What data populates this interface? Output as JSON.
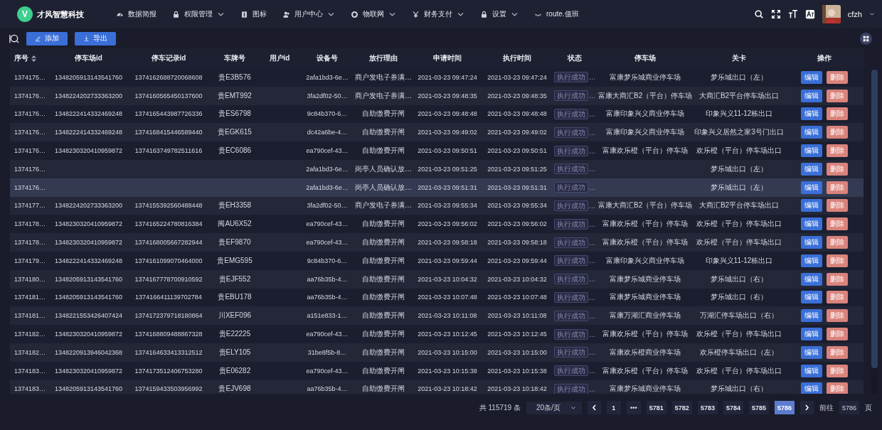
{
  "brand": {
    "logo_letter": "V",
    "name": "才风智慧科技"
  },
  "nav": [
    {
      "label": "数据简报",
      "kind": "dashboard",
      "dropdown": false
    },
    {
      "label": "权限管理",
      "kind": "lock",
      "dropdown": true
    },
    {
      "label": "图标",
      "kind": "info",
      "dropdown": false
    },
    {
      "label": "用户中心",
      "kind": "users",
      "dropdown": true
    },
    {
      "label": "物联网",
      "kind": "ring",
      "dropdown": true
    },
    {
      "label": "财务支付",
      "kind": "yen",
      "dropdown": true
    },
    {
      "label": "设置",
      "kind": "lock",
      "dropdown": true
    },
    {
      "label": "route.值班",
      "kind": "eye",
      "dropdown": false
    }
  ],
  "user": {
    "name": "cfzh"
  },
  "toolbar": {
    "buttons": [
      {
        "label": "添加",
        "kind": "edit"
      },
      {
        "label": "导出",
        "kind": "download"
      }
    ]
  },
  "table": {
    "columns": [
      {
        "label": "序号",
        "sortable": true
      },
      {
        "label": "停车场id",
        "sortable": false
      },
      {
        "label": "停车记录id",
        "sortable": false
      },
      {
        "label": "车牌号",
        "sortable": false
      },
      {
        "label": "用户id",
        "sortable": false
      },
      {
        "label": "设备号",
        "sortable": false
      },
      {
        "label": "放行理由",
        "sortable": false
      },
      {
        "label": "申请时间",
        "sortable": false
      },
      {
        "label": "执行时间",
        "sortable": false
      },
      {
        "label": "状态",
        "sortable": false
      },
      {
        "label": "停车场",
        "sortable": false
      },
      {
        "label": "关卡",
        "sortable": false
      },
      {
        "label": "操作",
        "sortable": false
      }
    ],
    "rows": [
      {
        "serial": "1374175…",
        "lot_id": "1348205913143541760",
        "record_id": "1374162688720068608",
        "plate": "贵E3B576",
        "device": "2afa1bd3-6e…",
        "reason": "商户发电子券满…",
        "apply_time": "2021-03-23 09:47:24",
        "exec_time": "2021-03-23 09:47:24",
        "status": "执行成功",
        "status_cut": "…",
        "lot": "富康梦乐城商业停车场",
        "gate": "梦乐城出口（左）",
        "edit": "编辑",
        "delete": "删除",
        "highlighted": false
      },
      {
        "serial": "1374176…",
        "lot_id": "1348224202733363200",
        "record_id": "1374160565450137600",
        "plate": "贵EMT992",
        "device": "3fa2df02-50…",
        "reason": "商户发电子券满…",
        "apply_time": "2021-03-23 09:48:35",
        "exec_time": "2021-03-23 09:48:35",
        "status": "执行成功",
        "status_cut": "…",
        "lot": "富康大商汇B2（平台）停车场",
        "gate": "大商汇B2平台停车场出口",
        "edit": "编辑",
        "delete": "删除",
        "highlighted": false
      },
      {
        "serial": "1374176…",
        "lot_id": "1348222414332469248",
        "record_id": "1374165443987726336",
        "plate": "贵ES6798",
        "device": "9c84b370-6…",
        "reason": "自助缴费开闸",
        "apply_time": "2021-03-23 09:48:48",
        "exec_time": "2021-03-23 09:48:48",
        "status": "执行成功",
        "status_cut": "…",
        "lot": "富康印象兴义商业停车场",
        "gate": "印象兴义11-12栋出口",
        "edit": "编辑",
        "delete": "删除",
        "highlighted": false
      },
      {
        "serial": "1374176…",
        "lot_id": "1348222414332469248",
        "record_id": "1374168415446589440",
        "plate": "贵EGK615",
        "device": "dc42a6be-4…",
        "reason": "自助缴费开闸",
        "apply_time": "2021-03-23 09:49:02",
        "exec_time": "2021-03-23 09:49:02",
        "status": "执行成功",
        "status_cut": "…",
        "lot": "富康印象兴义商业停车场",
        "gate": "印象兴义居然之家3号门出口",
        "edit": "编辑",
        "delete": "删除",
        "highlighted": false
      },
      {
        "serial": "1374176…",
        "lot_id": "1348230320410959872",
        "record_id": "1374163749782511616",
        "plate": "贵EC6086",
        "device": "ea790cef-43…",
        "reason": "自助缴费开闸",
        "apply_time": "2021-03-23 09:50:51",
        "exec_time": "2021-03-23 09:50:51",
        "status": "执行成功",
        "status_cut": "…",
        "lot": "富康欢乐橙（平台）停车场",
        "gate": "欢乐橙（平台）停车场出口",
        "edit": "编辑",
        "delete": "删除",
        "highlighted": false
      },
      {
        "serial": "1374176…",
        "device": "2afa1bd3-6e…",
        "reason": "岗亭人员确认放…",
        "apply_time": "2021-03-23 09:51:25",
        "exec_time": "2021-03-23 09:51:25",
        "status": "执行成功",
        "status_cut": "…",
        "gate": "梦乐城出口（左）",
        "edit": "编辑",
        "delete": "删除",
        "highlighted": false
      },
      {
        "serial": "1374176…",
        "device": "2afa1bd3-6e…",
        "reason": "岗亭人员确认放…",
        "apply_time": "2021-03-23 09:51:31",
        "exec_time": "2021-03-23 09:51:31",
        "status": "执行成功",
        "status_cut": "…",
        "gate": "梦乐城出口（左）",
        "edit": "编辑",
        "delete": "删除",
        "highlighted": true
      },
      {
        "serial": "1374177…",
        "lot_id": "1348224202733363200",
        "record_id": "1374155392560488448",
        "plate": "贵EH3358",
        "device": "3fa2df02-50…",
        "reason": "商户发电子券满…",
        "apply_time": "2021-03-23 09:55:34",
        "exec_time": "2021-03-23 09:55:34",
        "status": "执行成功",
        "status_cut": "…",
        "lot": "富康大商汇B2（平台）停车场",
        "gate": "大商汇B2平台停车场出口",
        "edit": "编辑",
        "delete": "删除",
        "highlighted": false
      },
      {
        "serial": "1374178…",
        "lot_id": "1348230320410959872",
        "record_id": "1374165224780816384",
        "plate": "闽AU6X52",
        "device": "ea790cef-43…",
        "reason": "自助缴费开闸",
        "apply_time": "2021-03-23 09:56:02",
        "exec_time": "2021-03-23 09:56:02",
        "status": "执行成功",
        "status_cut": "…",
        "lot": "富康欢乐橙（平台）停车场",
        "gate": "欢乐橙（平台）停车场出口",
        "edit": "编辑",
        "delete": "删除",
        "highlighted": false
      },
      {
        "serial": "1374178…",
        "lot_id": "1348230320410959872",
        "record_id": "1374168005667282944",
        "plate": "贵EF9870",
        "device": "ea790cef-43…",
        "reason": "自助缴费开闸",
        "apply_time": "2021-03-23 09:58:18",
        "exec_time": "2021-03-23 09:58:18",
        "status": "执行成功",
        "status_cut": "…",
        "lot": "富康欢乐橙（平台）停车场",
        "gate": "欢乐橙（平台）停车场出口",
        "edit": "编辑",
        "delete": "删除",
        "highlighted": false
      },
      {
        "serial": "1374179…",
        "lot_id": "1348222414332469248",
        "record_id": "1374161099070464000",
        "plate": "贵EMG595",
        "device": "9c84b370-6…",
        "reason": "自助缴费开闸",
        "apply_time": "2021-03-23 09:59:44",
        "exec_time": "2021-03-23 09:59:44",
        "status": "执行成功",
        "status_cut": "…",
        "lot": "富康印象兴义商业停车场",
        "gate": "印象兴义11-12栋出口",
        "edit": "编辑",
        "delete": "删除",
        "highlighted": false
      },
      {
        "serial": "1374180…",
        "lot_id": "1348205913143541760",
        "record_id": "1374167778700910592",
        "plate": "贵EJF552",
        "device": "aa76b35b-4…",
        "reason": "自助缴费开闸",
        "apply_time": "2021-03-23 10:04:32",
        "exec_time": "2021-03-23 10:04:32",
        "status": "执行成功",
        "status_cut": "…",
        "lot": "富康梦乐城商业停车场",
        "gate": "梦乐城出口（右）",
        "edit": "编辑",
        "delete": "删除",
        "highlighted": false
      },
      {
        "serial": "1374181…",
        "lot_id": "1348205913143541760",
        "record_id": "1374166411139702784",
        "plate": "贵EBU178",
        "device": "aa76b35b-4…",
        "reason": "自助缴费开闸",
        "apply_time": "2021-03-23 10:07:48",
        "exec_time": "2021-03-23 10:07:48",
        "status": "执行成功",
        "status_cut": "…",
        "lot": "富康梦乐城商业停车场",
        "gate": "梦乐城出口（右）",
        "edit": "编辑",
        "delete": "删除",
        "highlighted": false
      },
      {
        "serial": "1374181…",
        "lot_id": "1348221553426407424",
        "record_id": "1374172379718180864",
        "plate": "川XEF096",
        "device": "a151e833-1…",
        "reason": "自助缴费开闸",
        "apply_time": "2021-03-23 10:11:08",
        "exec_time": "2021-03-23 10:11:08",
        "status": "执行成功",
        "status_cut": "…",
        "lot": "富康万湖汇商业停车场",
        "gate": "万湖汇停车场出口（右）",
        "edit": "编辑",
        "delete": "删除",
        "highlighted": false
      },
      {
        "serial": "1374182…",
        "lot_id": "1348230320410959872",
        "record_id": "1374168809488867328",
        "plate": "贵E22225",
        "device": "ea790cef-43…",
        "reason": "自助缴费开闸",
        "apply_time": "2021-03-23 10:12:45",
        "exec_time": "2021-03-23 10:12:45",
        "status": "执行成功",
        "status_cut": "…",
        "lot": "富康欢乐橙（平台）停车场",
        "gate": "欢乐橙（平台）停车场出口",
        "edit": "编辑",
        "delete": "删除",
        "highlighted": false
      },
      {
        "serial": "1374182…",
        "lot_id": "1348220913946042368",
        "record_id": "1374164633413312512",
        "plate": "贵ELY105",
        "device": "31be8f5b-8…",
        "reason": "自助缴费开闸",
        "apply_time": "2021-03-23 10:15:00",
        "exec_time": "2021-03-23 10:15:00",
        "status": "执行成功",
        "status_cut": "…",
        "lot": "富康欢乐橙商业停车场",
        "gate": "欢乐橙停车场出口（左）",
        "edit": "编辑",
        "delete": "删除",
        "highlighted": false
      },
      {
        "serial": "1374183…",
        "lot_id": "1348230320410959872",
        "record_id": "1374173512406753280",
        "plate": "贵E06282",
        "device": "ea790cef-43…",
        "reason": "自助缴费开闸",
        "apply_time": "2021-03-23 10:15:38",
        "exec_time": "2021-03-23 10:15:38",
        "status": "执行成功",
        "status_cut": "…",
        "lot": "富康欢乐橙（平台）停车场",
        "gate": "欢乐橙（平台）停车场出口",
        "edit": "编辑",
        "delete": "删除",
        "highlighted": false
      },
      {
        "serial": "1374183…",
        "lot_id": "1348205913143541760",
        "record_id": "1374159433503956992",
        "plate": "贵EJV698",
        "device": "aa76b35b-4…",
        "reason": "自助缴费开闸",
        "apply_time": "2021-03-23 10:18:42",
        "exec_time": "2021-03-23 10:18:42",
        "status": "执行成功",
        "status_cut": "…",
        "lot": "富康梦乐城商业停车场",
        "gate": "梦乐城出口（右）",
        "edit": "编辑",
        "delete": "删除",
        "highlighted": false
      }
    ]
  },
  "pagination": {
    "total": "共 115719 条",
    "page_size": "20条/页",
    "pages": [
      {
        "label": "1",
        "selected": false
      },
      {
        "label": "•••",
        "selected": false
      },
      {
        "label": "5781",
        "selected": false
      },
      {
        "label": "5782",
        "selected": false
      },
      {
        "label": "5783",
        "selected": false
      },
      {
        "label": "5784",
        "selected": false
      },
      {
        "label": "5785",
        "selected": false
      },
      {
        "label": "5786",
        "selected": true
      }
    ],
    "goto_label": "前往",
    "goto_value": "5786",
    "goto_suffix": "页"
  }
}
